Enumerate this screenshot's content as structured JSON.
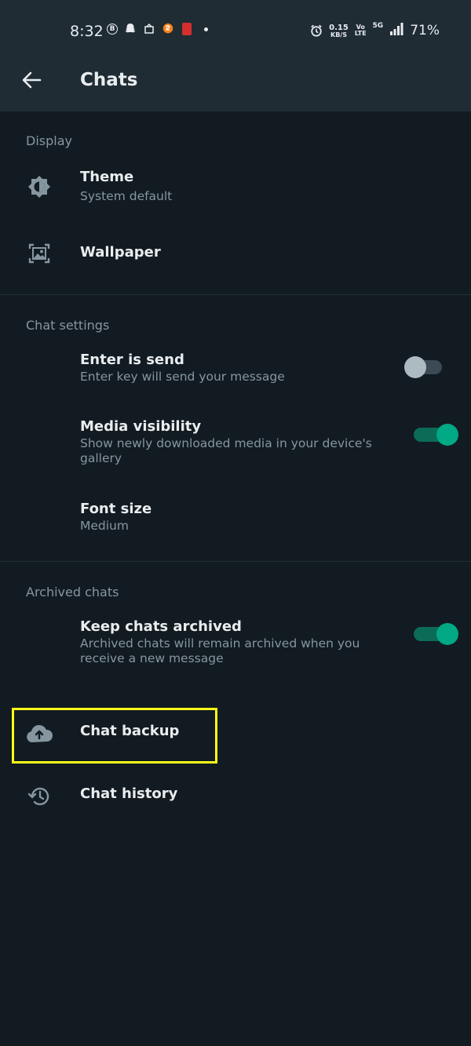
{
  "status_bar": {
    "time": "8:32",
    "net_speed_value": "0.15",
    "net_speed_unit": "KB/S",
    "volte_top": "Vo",
    "volte_bottom": "LTE",
    "network": "5G",
    "battery": "71%",
    "left_icons": [
      "b-circle-icon",
      "snapchat-icon",
      "notification-icon",
      "swiggy-icon",
      "app-icon",
      "dot-icon"
    ]
  },
  "header": {
    "title": "Chats"
  },
  "sections": {
    "display": {
      "title": "Display",
      "theme_title": "Theme",
      "theme_sub": "System default",
      "wallpaper_title": "Wallpaper"
    },
    "chat_settings": {
      "title": "Chat settings",
      "enter_send_title": "Enter is send",
      "enter_send_sub": "Enter key will send your message",
      "enter_send_on": false,
      "media_visibility_title": "Media visibility",
      "media_visibility_sub": "Show newly downloaded media in your device's gallery",
      "media_visibility_on": true,
      "font_size_title": "Font size",
      "font_size_sub": "Medium"
    },
    "archived_chats": {
      "title": "Archived chats",
      "keep_archived_title": "Keep chats archived",
      "keep_archived_sub": "Archived chats will remain archived when you receive a new message",
      "keep_archived_on": true
    }
  },
  "extra": {
    "chat_backup": "Chat backup",
    "chat_history": "Chat history"
  },
  "colors": {
    "background": "#121b22",
    "bar": "#1f2c34",
    "accent": "#00a884",
    "highlight": "#ffff1a"
  }
}
